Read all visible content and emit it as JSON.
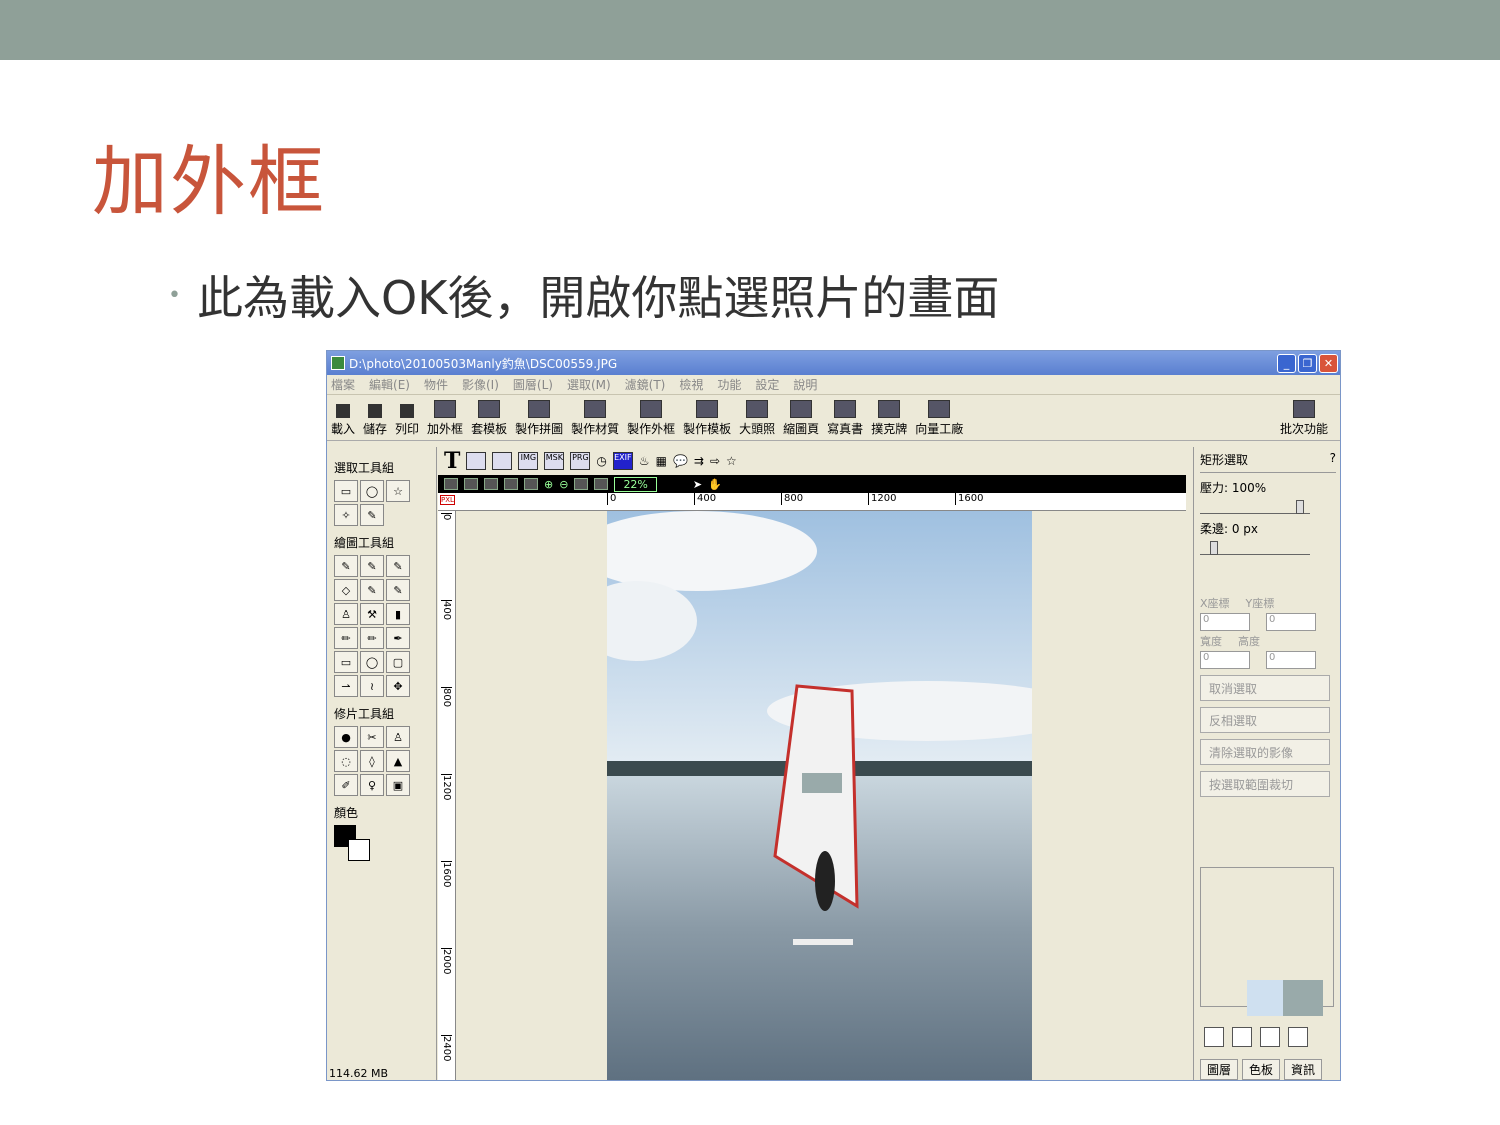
{
  "slide": {
    "title": "加外框",
    "bullet": "此為載入OK後，開啟你點選照片的畫面"
  },
  "window": {
    "title": "D:\\photo\\20100503Manly釣魚\\DSC00559.JPG"
  },
  "menu": [
    "檔案",
    "編輯(E)",
    "物件",
    "影像(I)",
    "圖層(L)",
    "選取(M)",
    "濾鏡(T)",
    "檢視",
    "功能",
    "設定",
    "說明"
  ],
  "toolbar": [
    "載入",
    "儲存",
    "列印",
    "加外框",
    "套模板",
    "製作拼圖",
    "製作材質",
    "製作外框",
    "製作模板",
    "大頭照",
    "縮圖頁",
    "寫真書",
    "撲克牌",
    "向量工廠",
    "批次功能"
  ],
  "left": {
    "select_group": "選取工具組",
    "draw_group": "繪圖工具組",
    "retouch_group": "修片工具組",
    "color_label": "顏色",
    "status": "114.62 MB"
  },
  "canvas": {
    "zoom": "22%",
    "pxl": "PXL",
    "ruler_x": [
      "0",
      "400",
      "800",
      "1200",
      "1600"
    ],
    "ruler_y": [
      "0",
      "400",
      "800",
      "1200",
      "1600",
      "2000",
      "2400"
    ],
    "tool_labels": [
      "IMG",
      "MSK",
      "PRG",
      "EXIF"
    ]
  },
  "right": {
    "tool_title": "矩形選取",
    "pressure": "壓力: 100%",
    "feather": "柔邊: 0 px",
    "x_label": "X座標",
    "y_label": "Y座標",
    "w_label": "寬度",
    "h_label": "高度",
    "coord_value": "0",
    "btn_cancel": "取消選取",
    "btn_invert": "反相選取",
    "btn_clear": "清除選取的影像",
    "btn_crop": "按選取範圍裁切",
    "tabs": [
      "圖層",
      "色板",
      "資訊"
    ]
  }
}
